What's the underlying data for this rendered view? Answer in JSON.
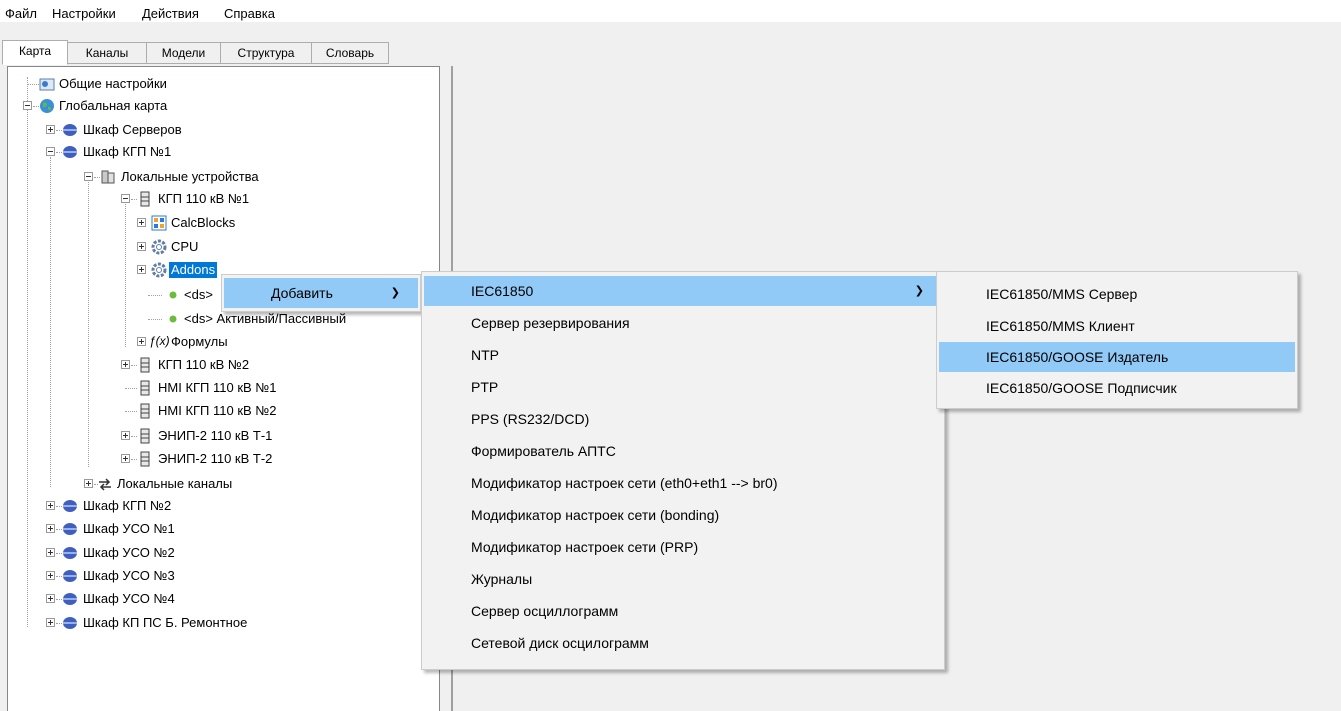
{
  "menubar": {
    "file": "Файл",
    "settings": "Настройки",
    "actions": "Действия",
    "help": "Справка"
  },
  "tabs": [
    {
      "label": "Карта"
    },
    {
      "label": "Каналы"
    },
    {
      "label": "Модели"
    },
    {
      "label": "Структура"
    },
    {
      "label": "Словарь"
    }
  ],
  "tree": {
    "general": "Общие настройки",
    "global_map": "Глобальная карта",
    "cab_servers": "Шкаф Серверов",
    "cab_kgp1": "Шкаф КГП №1",
    "local_devices": "Локальные устройства",
    "kgp110_1": "КГП 110 кВ №1",
    "calcblocks": "CalcBlocks",
    "cpu": "CPU",
    "addons": "Addons",
    "ds1": "<ds>",
    "ds2": "<ds> Активный/Пассивный",
    "formulas": "Формулы",
    "kgp110_2": "КГП 110 кВ №2",
    "hmi1": "HMI КГП 110 кВ №1",
    "hmi2": "HMI КГП 110 кВ №2",
    "enip1": "ЭНИП-2 110 кВ Т-1",
    "enip2": "ЭНИП-2 110 кВ Т-2",
    "local_channels": "Локальные каналы",
    "cab_kgp2": "Шкаф КГП №2",
    "cab_uso1": "Шкаф УСО №1",
    "cab_uso2": "Шкаф УСО №2",
    "cab_uso3": "Шкаф УСО №3",
    "cab_uso4": "Шкаф УСО №4",
    "cab_kp": "Шкаф КП ПС Б. Ремонтное"
  },
  "context_menu": {
    "add": "Добавить"
  },
  "add_submenu": [
    "IEC61850",
    "Сервер резервирования",
    "NTP",
    "PTP",
    "PPS (RS232/DCD)",
    "Формирователь АПТС",
    "Модификатор настроек сети (eth0+eth1 --> br0)",
    "Модификатор настроек сети (bonding)",
    "Модификатор настроек сети (PRP)",
    "Журналы",
    "Сервер осциллограмм",
    "Сетевой диск осцилограмм"
  ],
  "iec_submenu": [
    "IEC61850/MMS Сервер",
    "IEC61850/MMS Клиент",
    "IEC61850/GOOSE Издатель",
    "IEC61850/GOOSE Подписчик"
  ],
  "arrow_glyph": "❯",
  "colors": {
    "highlight": "#91c9f7",
    "tree_selection": "#0078d7"
  }
}
